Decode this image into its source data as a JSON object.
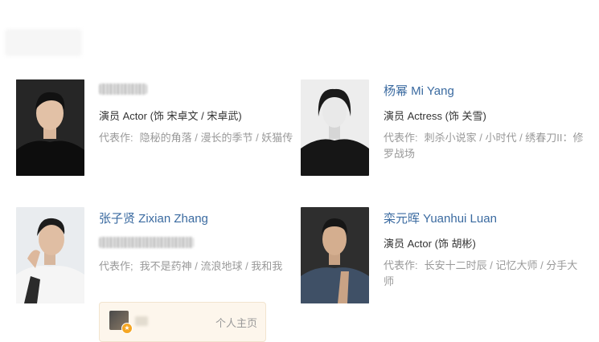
{
  "actors": [
    {
      "name": "",
      "role": "演员 Actor (饰 宋卓文 / 宋卓武)",
      "works_label": "代表作:",
      "works": "隐秘的角落 / 漫长的季节 / 妖猫传"
    },
    {
      "name": "杨幂 Mi Yang",
      "role": "演员 Actress (饰 关雪)",
      "works_label": "代表作:",
      "works": "刺杀小说家 / 小时代 / 绣春刀II：修罗战场"
    },
    {
      "name": "张子贤 Zixian Zhang",
      "role": "",
      "works_label": "代表作;",
      "works": "我不是药神 / 流浪地球 / 我和我"
    },
    {
      "name": "栾元晖 Yuanhui Luan",
      "role": "演员 Actor (饰 胡彬)",
      "works_label": "代表作:",
      "works": "长安十二时辰 / 记忆大师 / 分手大师"
    }
  ],
  "homepage": {
    "label": "个人主页",
    "badge_icon": "star-badge-icon"
  },
  "colors": {
    "name_link": "#3a6aa0",
    "muted": "#999999",
    "text": "#333333",
    "homepage_bg": "#fdf6ec"
  }
}
